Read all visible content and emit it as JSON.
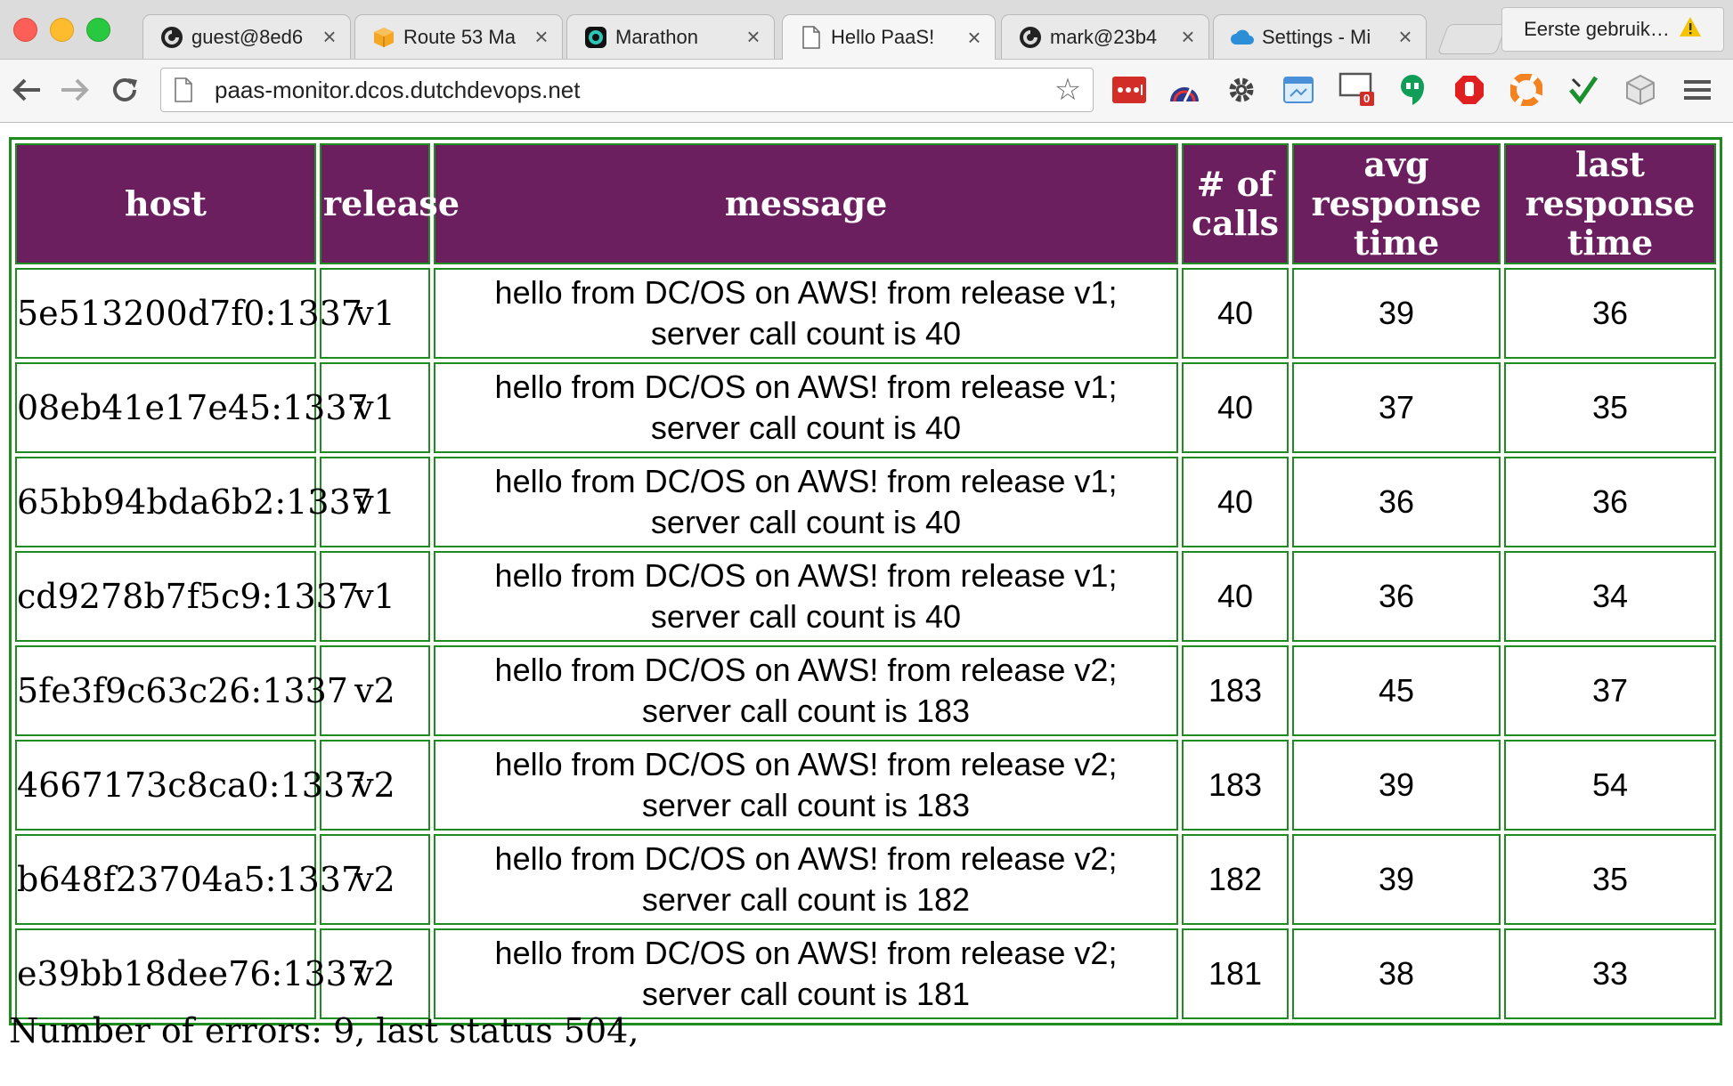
{
  "browser": {
    "tabs": [
      {
        "title": "guest@8ed6",
        "icon": "terminal-swirl-icon",
        "active": false
      },
      {
        "title": "Route 53 Ma",
        "icon": "aws-cube-icon",
        "active": false
      },
      {
        "title": "Marathon",
        "icon": "marathon-icon",
        "active": false
      },
      {
        "title": "Hello PaaS!",
        "icon": "page-icon",
        "active": true
      },
      {
        "title": "mark@23b4",
        "icon": "terminal-swirl-icon",
        "active": false
      },
      {
        "title": "Settings - Mi",
        "icon": "cloud-icon",
        "active": false
      }
    ],
    "profile_name": "Eerste gebruik…",
    "url": "paas-monitor.dcos.dutchdevops.net",
    "extension_badge": "0"
  },
  "table": {
    "headers": {
      "host": "host",
      "release": "release",
      "message": "message",
      "calls_line1": "# of",
      "calls_line2": "calls",
      "avg_line1": "avg response",
      "avg_line2": "time",
      "last_line1": "last response",
      "last_line2": "time"
    },
    "rows": [
      {
        "host": "5e513200d7f0:1337",
        "release": "v1",
        "message_line1": "hello from DC/OS on AWS! from release v1;",
        "message_line2": "server call count is 40",
        "calls": "40",
        "avg": "39",
        "last": "36"
      },
      {
        "host": "08eb41e17e45:1337",
        "release": "v1",
        "message_line1": "hello from DC/OS on AWS! from release v1;",
        "message_line2": "server call count is 40",
        "calls": "40",
        "avg": "37",
        "last": "35"
      },
      {
        "host": "65bb94bda6b2:1337",
        "release": "v1",
        "message_line1": "hello from DC/OS on AWS! from release v1;",
        "message_line2": "server call count is 40",
        "calls": "40",
        "avg": "36",
        "last": "36"
      },
      {
        "host": "cd9278b7f5c9:1337",
        "release": "v1",
        "message_line1": "hello from DC/OS on AWS! from release v1;",
        "message_line2": "server call count is 40",
        "calls": "40",
        "avg": "36",
        "last": "34"
      },
      {
        "host": "5fe3f9c63c26:1337",
        "release": "v2",
        "message_line1": "hello from DC/OS on AWS! from release v2;",
        "message_line2": "server call count is 183",
        "calls": "183",
        "avg": "45",
        "last": "37"
      },
      {
        "host": "4667173c8ca0:1337",
        "release": "v2",
        "message_line1": "hello from DC/OS on AWS! from release v2;",
        "message_line2": "server call count is 183",
        "calls": "183",
        "avg": "39",
        "last": "54"
      },
      {
        "host": "b648f23704a5:1337",
        "release": "v2",
        "message_line1": "hello from DC/OS on AWS! from release v2;",
        "message_line2": "server call count is 182",
        "calls": "182",
        "avg": "39",
        "last": "35"
      },
      {
        "host": "e39bb18dee76:1337",
        "release": "v2",
        "message_line1": "hello from DC/OS on AWS! from release v2;",
        "message_line2": "server call count is 181",
        "calls": "181",
        "avg": "38",
        "last": "33"
      }
    ]
  },
  "status_text": "Number of errors: 9, last status 504,",
  "colors": {
    "header_bg": "#6b1f5e",
    "border": "#1f8c1f"
  }
}
